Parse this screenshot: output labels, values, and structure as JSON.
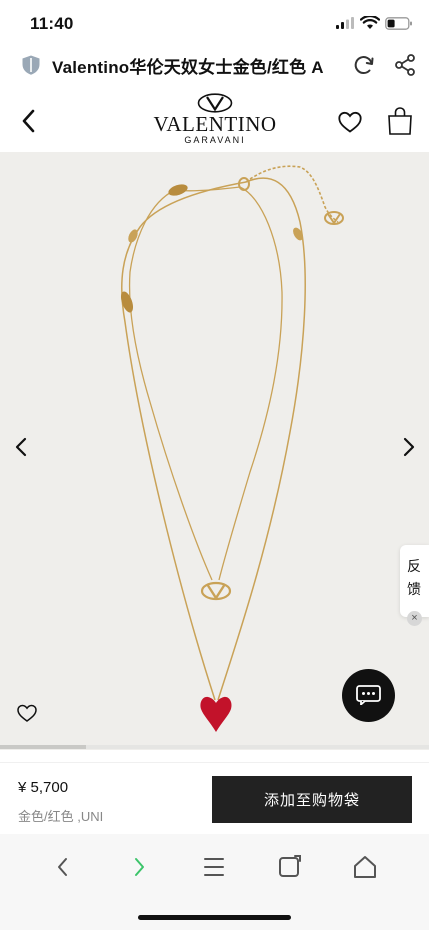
{
  "status_bar": {
    "time": "11:40"
  },
  "browser": {
    "page_title": "Valentino华伦天奴女士金色/红色 A"
  },
  "site": {
    "logo_text": "VALENTINO",
    "logo_subtext": "GARAVANI"
  },
  "product": {
    "price": "¥ 5,700",
    "variant": "金色/红色 ,UNI",
    "add_to_bag_label": "添加至购物袋",
    "gallery_progress": 0.2
  },
  "feedback": {
    "label": "反馈",
    "close_glyph": "×"
  },
  "colors": {
    "gallery_bg": "#efeeeb",
    "gold_chain": "#c9a257",
    "heart_red": "#c2122a",
    "button_dark": "#222222",
    "nav_accent": "#3cc46a"
  },
  "icons": {
    "back": "chevron-left-icon",
    "wishlist": "heart-icon",
    "bag": "shopping-bag-icon",
    "reload": "reload-icon",
    "share": "share-icon",
    "chat": "chat-icon"
  }
}
